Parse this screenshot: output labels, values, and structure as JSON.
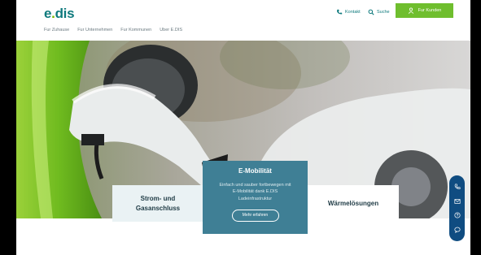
{
  "header": {
    "logo": {
      "text_main": "e",
      "text_dot": ".",
      "text_rest": "dis"
    },
    "nav": [
      "Fur Zuhause",
      "Fur Unternehmen",
      "Fur Kommunen",
      "Uber E.DIS"
    ],
    "utilities": [
      {
        "icon": "phone-icon",
        "label": "Kontakt"
      },
      {
        "icon": "search-icon",
        "label": "Suche"
      }
    ],
    "cta": {
      "icon": "user-icon",
      "label": "Fur Kunden"
    }
  },
  "hero": {
    "image": "electric-car-charging-plug"
  },
  "cards": {
    "left": {
      "line1": "Strom- und",
      "line2": "Gasanschluss"
    },
    "main": {
      "title": "E-Mobilität",
      "desc_line1": "Einfach und sauber fortbewegen mit",
      "desc_line2": "E-Mobilität dank E.DIS",
      "desc_line3": "Ladeinfrastruktur",
      "button": "Mehr erfahren"
    },
    "right": {
      "label": "Wärmelösungen"
    }
  },
  "sidebar": [
    "phone-icon",
    "mail-icon",
    "faq-icon",
    "chat-icon"
  ],
  "colors": {
    "brand": "#0f7a7d",
    "accent": "#6fbe2e",
    "card_main": "#3f7f95",
    "side": "#0f4c81"
  }
}
